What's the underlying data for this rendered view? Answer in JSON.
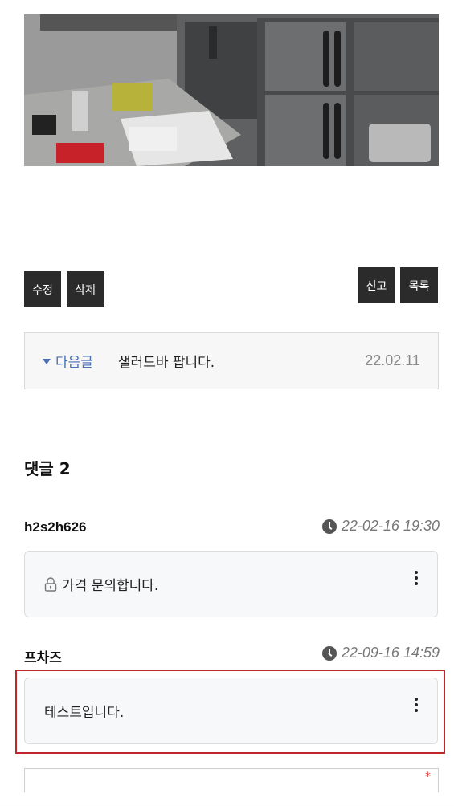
{
  "post_actions": {
    "edit_label": "수정",
    "delete_label": "삭제",
    "report_label": "신고",
    "list_label": "목록"
  },
  "next_post": {
    "label": "다음글",
    "title": "샐러드바 팝니다.",
    "date": "22.02.11"
  },
  "comments": {
    "heading": "댓글 2",
    "items": [
      {
        "author": "h2s2h626",
        "time": "22-02-16 19:30",
        "text": "가격 문의합니다.",
        "secret": true
      },
      {
        "author": "프차즈",
        "time": "22-09-16 14:59",
        "text": "테스트입니다.",
        "secret": false
      }
    ]
  },
  "reply_form": {
    "required_mark": "*"
  },
  "colors": {
    "button_bg": "#2b2b2b",
    "link_blue": "#4a6fb5",
    "highlight_red": "#c0262c"
  },
  "icons": [
    "clock-icon",
    "lock-icon",
    "more-vertical-icon",
    "caret-down-icon"
  ]
}
